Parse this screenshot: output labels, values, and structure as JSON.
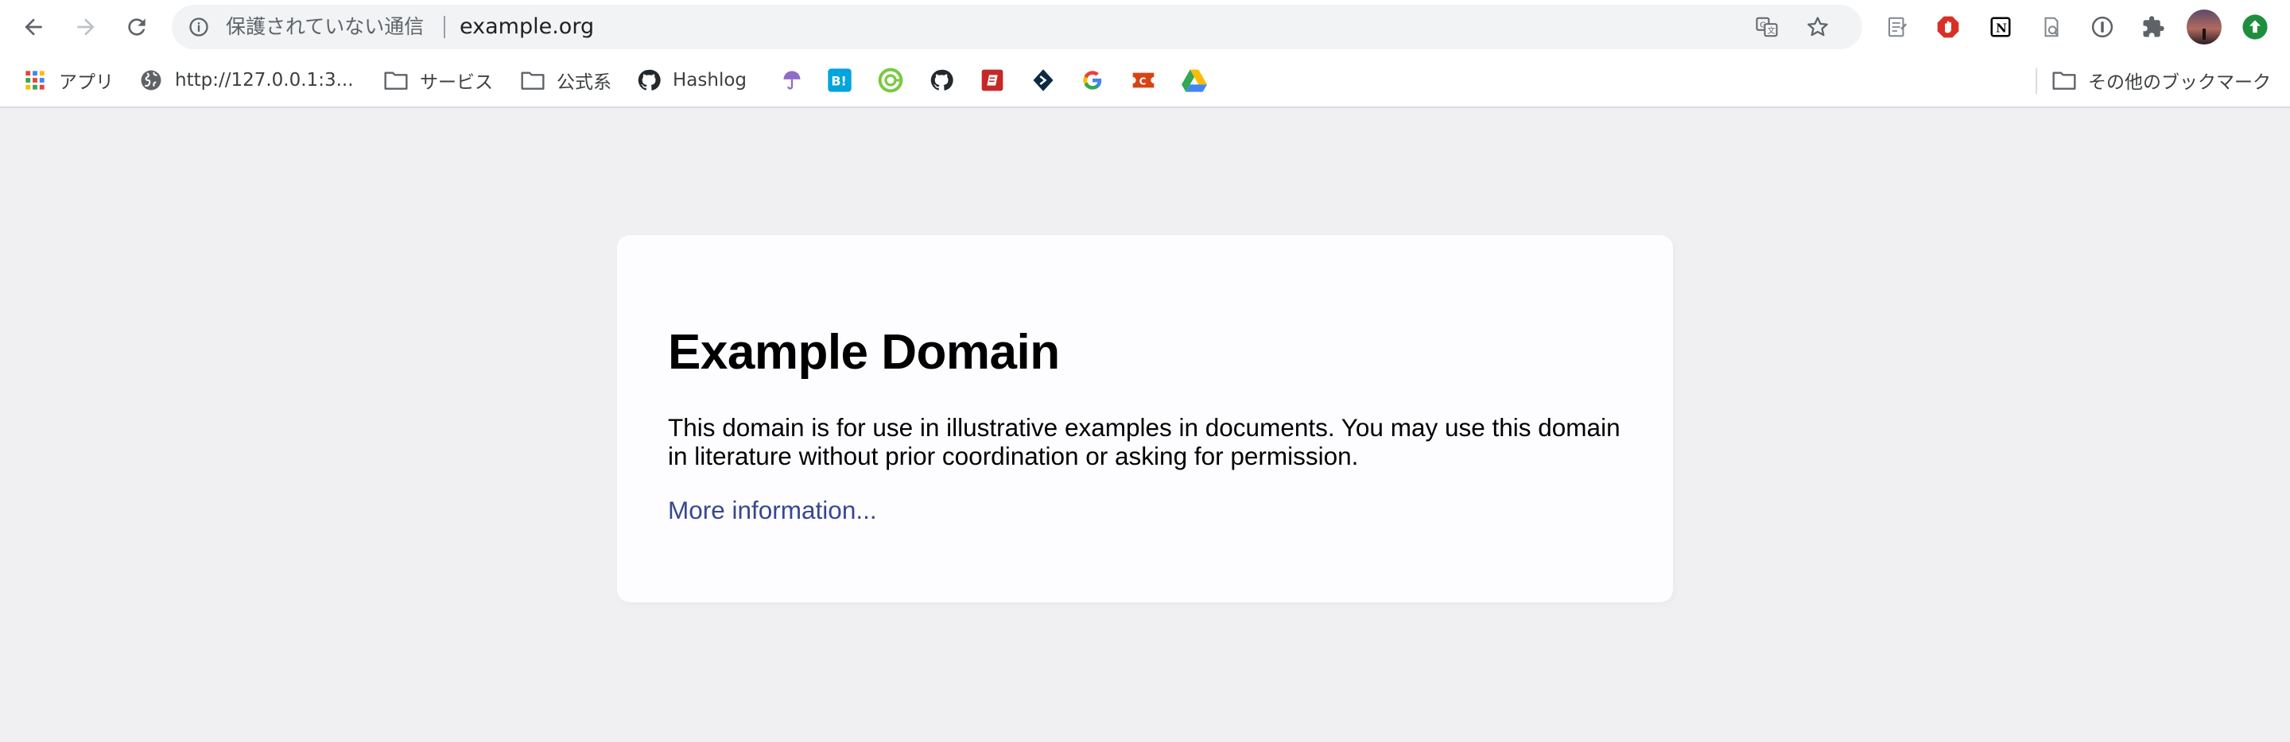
{
  "browser": {
    "nav": {
      "back_icon": "arrow-left-icon",
      "forward_icon": "arrow-right-icon",
      "reload_icon": "reload-icon"
    },
    "omnibox": {
      "security_text": "保護されていない通信",
      "url": "example.org",
      "icons": [
        "info-icon",
        "translate-icon",
        "star-icon"
      ]
    },
    "extensions": [
      "notes-extension-icon",
      "adblock-extension-icon",
      "notion-extension-icon",
      "feed-extension-icon",
      "password-manager-icon",
      "puzzle-extensions-icon",
      "profile-avatar",
      "update-icon"
    ]
  },
  "bookmarks": {
    "items": [
      {
        "label": "アプリ",
        "icon": "apps-grid-icon"
      },
      {
        "label": "http://127.0.0.1:3...",
        "icon": "globe-icon"
      },
      {
        "label": "サービス",
        "icon": "folder-icon"
      },
      {
        "label": "公式系",
        "icon": "folder-icon"
      },
      {
        "label": "Hashlog",
        "icon": "github-icon"
      }
    ],
    "icon_only": [
      "umbrella-icon",
      "hatena-bookmark-icon",
      "green-circle-icon",
      "github-icon",
      "red-book-icon",
      "dark-diamond-icon",
      "google-icon",
      "red-ticket-icon",
      "google-drive-icon"
    ],
    "other_label": "その他のブックマーク"
  },
  "page": {
    "title": "Example Domain",
    "body": "This domain is for use in illustrative examples in documents. You may use this domain in literature without prior coordination or asking for permission.",
    "link_text": "More information..."
  },
  "colors": {
    "page_bg": "#f0f0f2",
    "card_bg": "#fdfdff",
    "link": "#38488f",
    "omnibox_bg": "#f1f3f4"
  }
}
